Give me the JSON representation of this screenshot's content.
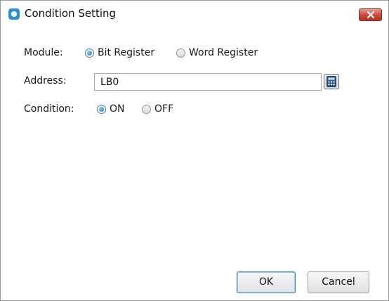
{
  "window": {
    "title": "Condition Setting",
    "app_icon": "app-logo-icon",
    "close_icon": "close-icon",
    "close_color": "#c7463a"
  },
  "module": {
    "label": "Module:",
    "options": [
      {
        "label": "Bit Register",
        "checked": true
      },
      {
        "label": "Word Register",
        "checked": false
      }
    ]
  },
  "address": {
    "label": "Address:",
    "value": "LB0",
    "picker_icon": "calculator-icon"
  },
  "condition": {
    "label": "Condition:",
    "options": [
      {
        "label": "ON",
        "checked": true
      },
      {
        "label": "OFF",
        "checked": false
      }
    ]
  },
  "buttons": {
    "ok": "OK",
    "cancel": "Cancel"
  }
}
